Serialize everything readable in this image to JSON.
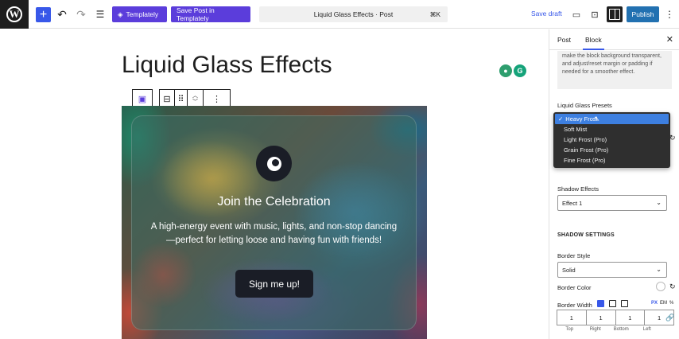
{
  "topbar": {
    "templately_label": "Templately",
    "save_templately_label": "Save Post in Templately",
    "doc_title": "Liquid Glass Effects · Post",
    "shortcut": "⌘K",
    "save_draft": "Save draft",
    "publish": "Publish"
  },
  "editor": {
    "post_title": "Liquid Glass Effects",
    "hero": {
      "heading": "Join the Celebration",
      "text": "A high-energy event with music, lights, and non-stop dancing—perfect for letting loose and having fun with friends!",
      "cta": "Sign me up!"
    }
  },
  "sidebar": {
    "tabs": [
      {
        "label": "Post"
      },
      {
        "label": "Block"
      }
    ],
    "notice": "make the block background transparent, and adjust/reset margin or padding if needed for a smoother effect.",
    "presets_label": "Liquid Glass Presets",
    "presets_options": [
      "Heavy Frost",
      "Soft Mist",
      "Light Frost (Pro)",
      "Grain Frost (Pro)",
      "Fine Frost (Pro)"
    ],
    "presets_selected": "Heavy Frost",
    "shadow_effects_label": "Shadow Effects",
    "shadow_effects_value": "Effect 1",
    "shadow_settings_heading": "SHADOW SETTINGS",
    "border_style_label": "Border Style",
    "border_style_value": "Solid",
    "border_color_label": "Border Color",
    "border_width_label": "Border Width",
    "units": [
      "PX",
      "EM",
      "%"
    ],
    "width_values": [
      "1",
      "1",
      "1",
      "1"
    ],
    "width_labels": [
      "Top",
      "Right",
      "Bottom",
      "Left"
    ]
  },
  "colors": {
    "accent": "#3858e9",
    "templately_purple": "#5b3ddb",
    "publish_blue": "#2271b1"
  }
}
